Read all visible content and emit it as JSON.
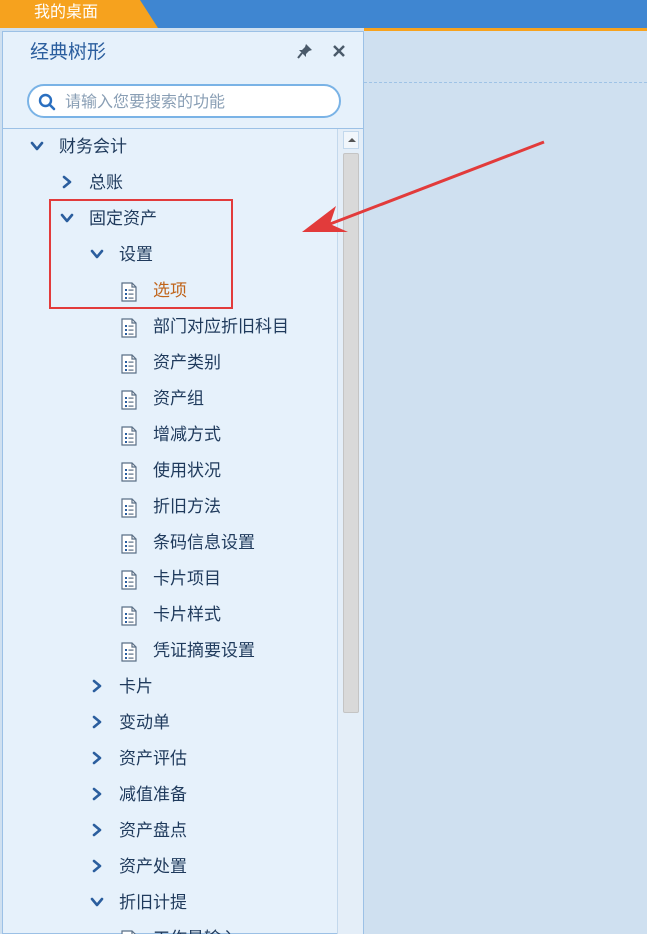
{
  "topbar": {
    "home_tab": "我的桌面",
    "colors": {
      "tab": "#f6a21e",
      "bar": "#3f86d1"
    }
  },
  "panel": {
    "title": "经典树形",
    "pin_icon": "pin-icon",
    "close_icon": "close-icon"
  },
  "search": {
    "placeholder": "请输入您要搜索的功能",
    "value": ""
  },
  "tree": {
    "items": [
      {
        "label": "财务会计",
        "level": 0,
        "kind": "folder",
        "expanded": true
      },
      {
        "label": "总账",
        "level": 1,
        "kind": "folder",
        "expanded": false
      },
      {
        "label": "固定资产",
        "level": 1,
        "kind": "folder",
        "expanded": true
      },
      {
        "label": "设置",
        "level": 2,
        "kind": "folder",
        "expanded": true
      },
      {
        "label": "选项",
        "level": 3,
        "kind": "leaf",
        "active": true
      },
      {
        "label": "部门对应折旧科目",
        "level": 3,
        "kind": "leaf"
      },
      {
        "label": "资产类别",
        "level": 3,
        "kind": "leaf"
      },
      {
        "label": "资产组",
        "level": 3,
        "kind": "leaf"
      },
      {
        "label": "增减方式",
        "level": 3,
        "kind": "leaf"
      },
      {
        "label": "使用状况",
        "level": 3,
        "kind": "leaf"
      },
      {
        "label": "折旧方法",
        "level": 3,
        "kind": "leaf"
      },
      {
        "label": "条码信息设置",
        "level": 3,
        "kind": "leaf"
      },
      {
        "label": "卡片项目",
        "level": 3,
        "kind": "leaf"
      },
      {
        "label": "卡片样式",
        "level": 3,
        "kind": "leaf"
      },
      {
        "label": "凭证摘要设置",
        "level": 3,
        "kind": "leaf"
      },
      {
        "label": "卡片",
        "level": 2,
        "kind": "folder",
        "expanded": false
      },
      {
        "label": "变动单",
        "level": 2,
        "kind": "folder",
        "expanded": false
      },
      {
        "label": "资产评估",
        "level": 2,
        "kind": "folder",
        "expanded": false
      },
      {
        "label": "减值准备",
        "level": 2,
        "kind": "folder",
        "expanded": false
      },
      {
        "label": "资产盘点",
        "level": 2,
        "kind": "folder",
        "expanded": false
      },
      {
        "label": "资产处置",
        "level": 2,
        "kind": "folder",
        "expanded": false
      },
      {
        "label": "折旧计提",
        "level": 2,
        "kind": "folder",
        "expanded": true
      },
      {
        "label": "工作量输入",
        "level": 3,
        "kind": "leaf"
      }
    ]
  },
  "annotation": {
    "color": "#e23b3b"
  }
}
